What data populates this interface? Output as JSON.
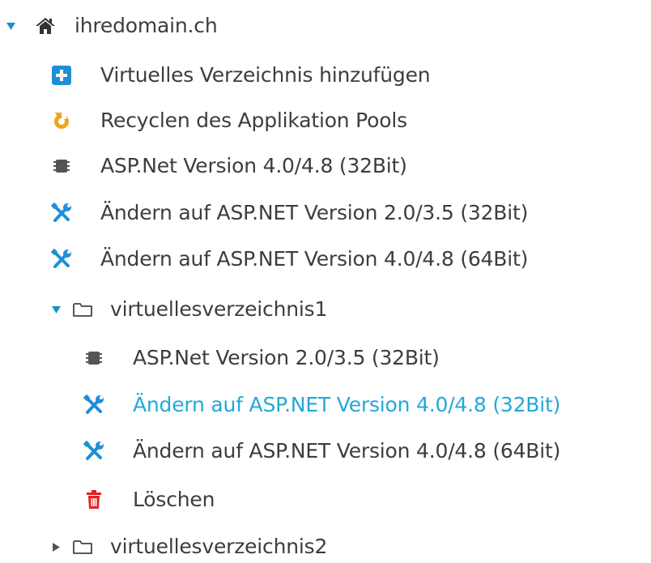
{
  "colors": {
    "text": "#3d3d3d",
    "active_link": "#23a8d9",
    "toggle": "#1b8fd0",
    "add_icon": "#1e8fd6",
    "recycle_icon": "#f2a31b",
    "tools_icon": "#1e8fd6",
    "chip_icon": "#555555",
    "delete_icon": "#e41f1f"
  },
  "tree": {
    "domain": {
      "label": "ihredomain.ch",
      "icon": "home-icon",
      "expanded": true,
      "actions": [
        {
          "label": "Virtuelles Verzeichnis hinzufügen",
          "icon": "plus-square-icon"
        },
        {
          "label": "Recyclen des Applikation Pools",
          "icon": "recycle-icon"
        },
        {
          "label": "ASP.Net Version 4.0/4.8 (32Bit)",
          "icon": "chip-icon"
        },
        {
          "label": "Ändern auf ASP.NET Version 2.0/3.5 (32Bit)",
          "icon": "tools-icon"
        },
        {
          "label": "Ändern auf ASP.NET Version 4.0/4.8 (64Bit)",
          "icon": "tools-icon"
        }
      ]
    },
    "vdir1": {
      "label": "virtuellesverzeichnis1",
      "icon": "folder-icon",
      "expanded": true,
      "actions": [
        {
          "label": "ASP.Net Version 2.0/3.5 (32Bit)",
          "icon": "chip-icon"
        },
        {
          "label": "Ändern auf ASP.NET Version 4.0/4.8 (32Bit)",
          "icon": "tools-icon",
          "highlighted": true
        },
        {
          "label": "Ändern auf ASP.NET Version 4.0/4.8 (64Bit)",
          "icon": "tools-icon"
        },
        {
          "label": "Löschen",
          "icon": "trash-icon"
        }
      ]
    },
    "vdir2": {
      "label": "virtuellesverzeichnis2",
      "icon": "folder-icon",
      "expanded": false
    }
  }
}
